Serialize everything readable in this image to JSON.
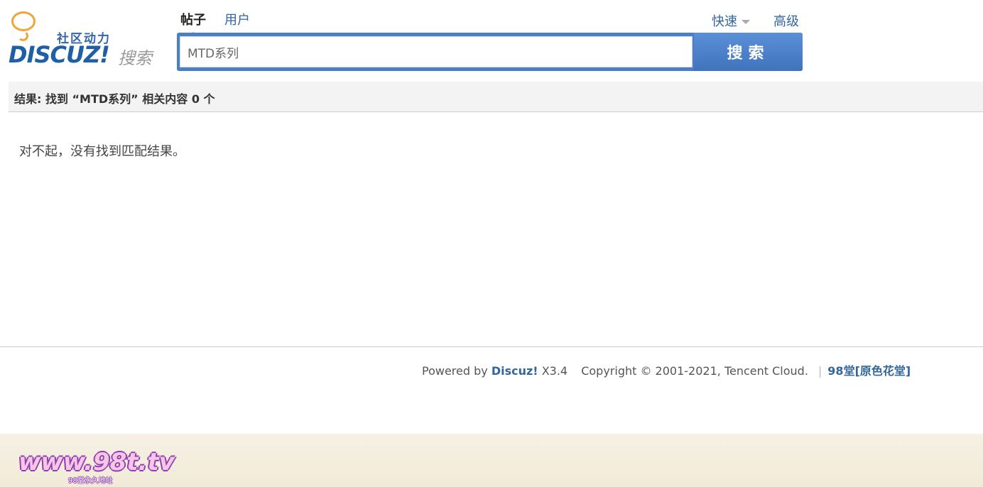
{
  "header": {
    "logo": {
      "tagline": "社区动力",
      "brand": "DISCUZ!",
      "suffix": "搜索"
    },
    "tabs": [
      {
        "label": "帖子",
        "active": true
      },
      {
        "label": "用户",
        "active": false
      }
    ],
    "quick_label": "快速",
    "advanced_label": "高级"
  },
  "search": {
    "value": "MTD系列",
    "button_label": "搜索"
  },
  "results": {
    "summary": "结果: 找到 “MTD系列” 相关内容 0 个",
    "empty_message": "对不起，没有找到匹配结果。"
  },
  "footer": {
    "powered_prefix": "Powered by",
    "brand": "Discuz!",
    "version": "X3.4",
    "copyright": "Copyright © 2001-2021, Tencent Cloud.",
    "separator": "|",
    "site_link": "98堂[原色花堂]"
  },
  "banner": {
    "logo_text": "www.98t.tv",
    "sub_text": "98堂永久地址"
  },
  "colors": {
    "accent": "#4a7fc5",
    "link": "#336699",
    "results_bar_bg": "#f3f3f3",
    "banner_bg": "#f3ecdb",
    "logo_orange": "#f2a33a"
  },
  "icons": {
    "quick_caret": "caret-down-icon",
    "tab_pointer": "pointer-up-icon"
  }
}
